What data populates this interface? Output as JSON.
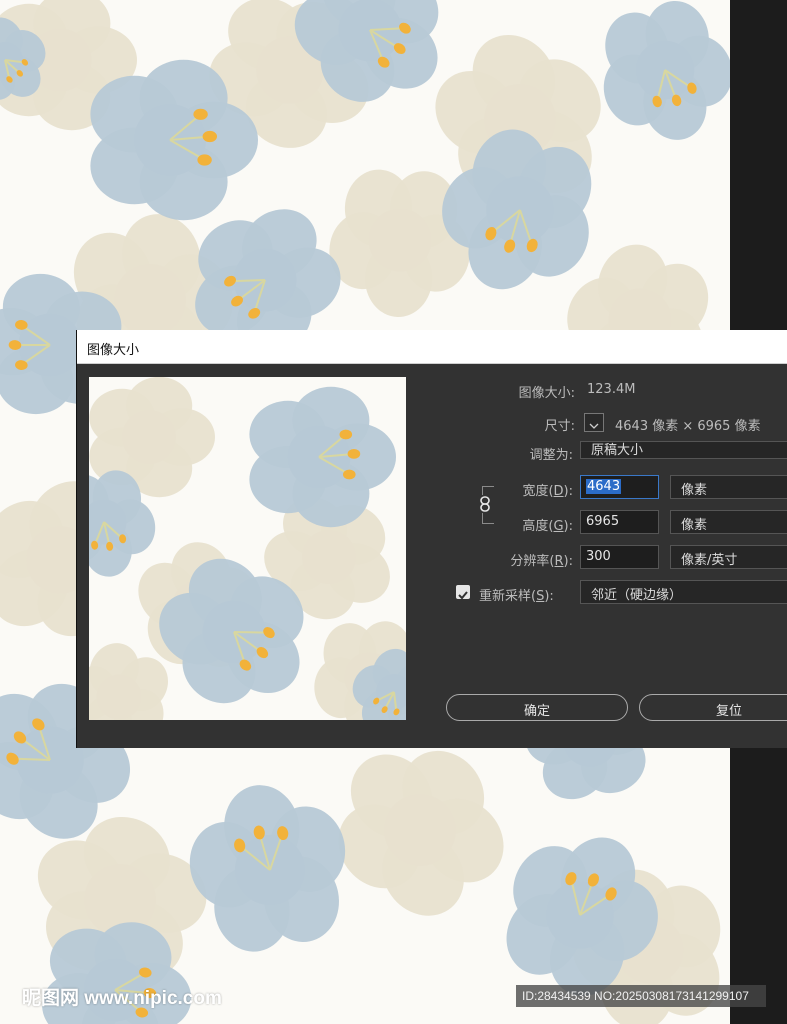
{
  "dialog": {
    "title": "图像大小",
    "image_size_label": "图像大小:",
    "image_size_value": "123.4M",
    "dimensions_label": "尺寸:",
    "dimensions_value": "4643 像素 × 6965 像素",
    "fit_to_label": "调整为:",
    "fit_to_value": "原稿大小",
    "width_label": "宽度(",
    "width_key": "D",
    "width_value": "4643",
    "width_unit": "像素",
    "height_label": "高度(",
    "height_key": "G",
    "height_value": "6965",
    "height_unit": "像素",
    "resolution_label": "分辨率(",
    "resolution_key": "R",
    "resolution_value": "300",
    "resolution_unit": "像素/英寸",
    "resample_label": "重新采样(",
    "resample_key": "S",
    "resample_checked": true,
    "resample_method": "邻近（硬边缘）",
    "label_close": "):",
    "ok_label": "确定",
    "reset_label": "复位"
  },
  "watermark": {
    "site": "昵图网 www.nipic.com",
    "id_text": "ID:28434539 NO:20250308173141299107"
  },
  "colors": {
    "dialog_bg": "#323232",
    "petal_blue": "#b7c9d6",
    "petal_beige": "#e8e1cf",
    "stamen_yellow": "#f2b23a",
    "selection_blue": "#2b6cc8"
  }
}
